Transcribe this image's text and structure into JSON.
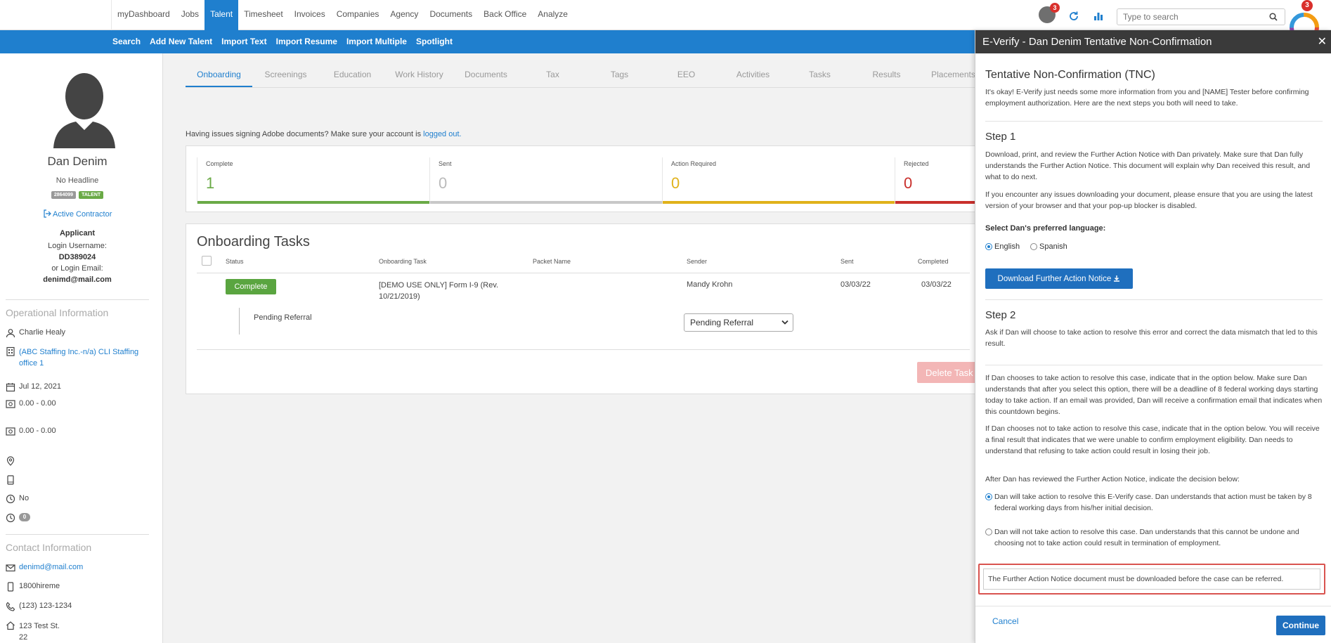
{
  "topnav": {
    "items": [
      "myDashboard",
      "Jobs",
      "Talent",
      "Timesheet",
      "Invoices",
      "Companies",
      "Agency",
      "Documents",
      "Back Office",
      "Analyze"
    ],
    "active_index": 2,
    "notification_count": "3",
    "widget_count": "3",
    "search_placeholder": "Type to search"
  },
  "subnav": {
    "items": [
      "Search",
      "Add New Talent",
      "Import Text",
      "Import Resume",
      "Import Multiple",
      "Spotlight"
    ]
  },
  "profile": {
    "name": "Dan Denim",
    "headline": "No Headline",
    "id_badge": "2864099",
    "type_badge": "TALENT",
    "status": "Active Contractor",
    "role": "Applicant",
    "login_username_label": "Login Username:",
    "login_username": "DD389024",
    "login_email_label": "or Login Email:",
    "login_email": "denimd@mail.com"
  },
  "operational": {
    "heading": "Operational Information",
    "recruiter": "Charlie Healy",
    "office": "(ABC Staffing Inc.-n/a) CLI Staffing office 1",
    "date": "Jul 12, 2021",
    "rate1": "0.00 - 0.00",
    "rate2": "0.00 - 0.00",
    "flag": "No",
    "count": "0"
  },
  "contact": {
    "heading": "Contact Information",
    "email": "denimd@mail.com",
    "phone1": "1800hireme",
    "phone2": "(123) 123-1234",
    "address1": "123 Test St.",
    "address2": "22"
  },
  "tabs": [
    "Onboarding",
    "Screenings",
    "Education",
    "Work History",
    "Documents",
    "Tax",
    "Tags",
    "EEO",
    "Activities",
    "Tasks",
    "Results",
    "Placements"
  ],
  "adobe": {
    "message": "Having issues signing Adobe documents? Make sure your account is",
    "link": "logged out."
  },
  "stats": [
    {
      "label": "Complete",
      "value": "1",
      "color": "#6aaa46"
    },
    {
      "label": "Sent",
      "value": "0",
      "color": "#c8c8c8"
    },
    {
      "label": "Action Required",
      "value": "0",
      "color": "#e0b21b"
    },
    {
      "label": "Rejected",
      "value": "0",
      "color": "#c9302c"
    }
  ],
  "tasks": {
    "heading": "Onboarding Tasks",
    "columns": [
      "Status",
      "Onboarding Task",
      "Packet Name",
      "Sender",
      "Sent",
      "Completed"
    ],
    "row": {
      "status": "Complete",
      "task": "[DEMO USE ONLY] Form I-9 (Rev. 10/21/2019)",
      "packet": "",
      "sender": "Mandy Krohn",
      "sent": "03/03/22",
      "completed": "03/03/22"
    },
    "sub_label": "Pending Referral",
    "sub_select": "Pending Referral",
    "delete_label": "Delete Task"
  },
  "panel": {
    "title": "E-Verify - Dan Denim Tentative Non-Confirmation",
    "heading": "Tentative Non-Confirmation (TNC)",
    "intro": "It's okay! E-Verify just needs some more information from you and [NAME] Tester before confirming employment authorization. Here are the next steps you both will need to take.",
    "step1": "Step 1",
    "step1_p1": "Download, print, and review the Further Action Notice with Dan privately. Make sure that Dan fully understands the Further Action Notice. This document will explain why Dan received this result, and what to do next.",
    "step1_p2": "If you encounter any issues downloading your document, please ensure that you are using the latest version of your browser and that your pop-up blocker is disabled.",
    "lang_label": "Select Dan's preferred language:",
    "lang_english": "English",
    "lang_spanish": "Spanish",
    "download_label": "Download Further Action Notice",
    "step2": "Step 2",
    "step2_p1": "Ask if Dan will choose to take action to resolve this error and correct the data mismatch that led to this result.",
    "step2_p2": "If Dan chooses to take action to resolve this case, indicate that in the option below. Make sure Dan understands that after you select this option, there will be a deadline of 8 federal working days starting today to take action. If an email was provided, Dan will receive a confirmation email that indicates when this countdown begins.",
    "step2_p3": "If Dan chooses not to take action to resolve this case, indicate that in the option below. You will receive a final result that indicates that we were unable to confirm employment eligibility. Dan needs to understand that refusing to take action could result in losing their job.",
    "step2_p4": "After Dan has reviewed the Further Action Notice, indicate the decision below:",
    "option_take": "Dan will take action to resolve this E-Verify case. Dan understands that action must be taken by 8 federal working days from his/her initial decision.",
    "option_not": "Dan will not take action to resolve this case. Dan understands that this cannot be undone and choosing not to take action could result in termination of employment.",
    "warning": "The Further Action Notice document must be downloaded before the case can be referred.",
    "cancel": "Cancel",
    "continue": "Continue"
  }
}
